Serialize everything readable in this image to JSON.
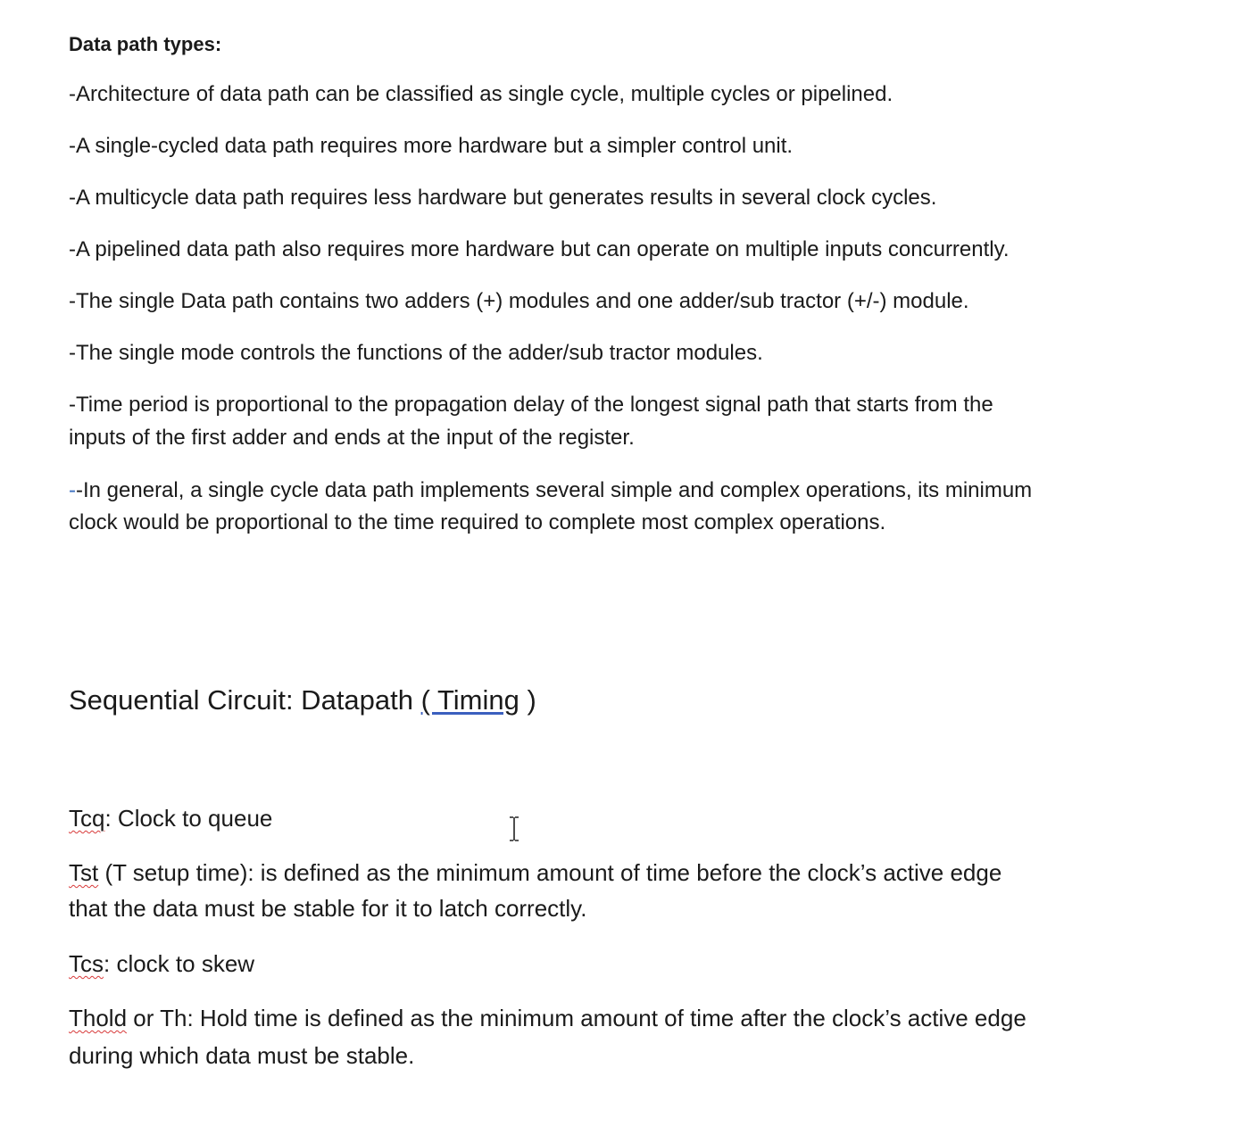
{
  "document": {
    "section1": {
      "heading": "Data path types:",
      "items": [
        "-Architecture of data path can be classified as single cycle, multiple cycles or pipelined.",
        "-A single-cycled data path requires more hardware but a simpler control unit.",
        "-A multicycle data path requires less hardware but generates results in several clock cycles.",
        "-A pipelined data path also requires more hardware but can operate on multiple inputs concurrently.",
        "-The single Data path contains two adders (+) modules and one adder/sub tractor (+/-) module.",
        "-The single mode controls the functions of the adder/sub tractor modules."
      ],
      "item7": {
        "line1": "-Time period is proportional to the propagation delay of the longest signal path that starts from the",
        "line2": "inputs of the first adder and ends at the input of the register."
      },
      "item8": {
        "mark": "-",
        "line1": "-In general, a single cycle data path implements several simple and complex operations, its minimum",
        "line2": "clock would be proportional to the time required to complete most complex operations."
      }
    },
    "section2": {
      "heading_main": "Sequential Circuit: Datapath ",
      "heading_link": "( Timing",
      "heading_end": " )",
      "tcq": {
        "term": "Tcq",
        "text": ":  Clock to queue"
      },
      "tst": {
        "term": "Tst",
        "line1": " (T setup time): is defined as the minimum amount of time before the clock’s active edge",
        "line2": "that the data must be stable for it to latch correctly."
      },
      "tcs": {
        "term": "Tcs",
        "text": ": clock to skew"
      },
      "thold": {
        "term": "Thold",
        "line1": " or Th: Hold time is defined as the minimum amount of time after the clock’s active edge",
        "line2": "during which data must be stable."
      }
    }
  }
}
